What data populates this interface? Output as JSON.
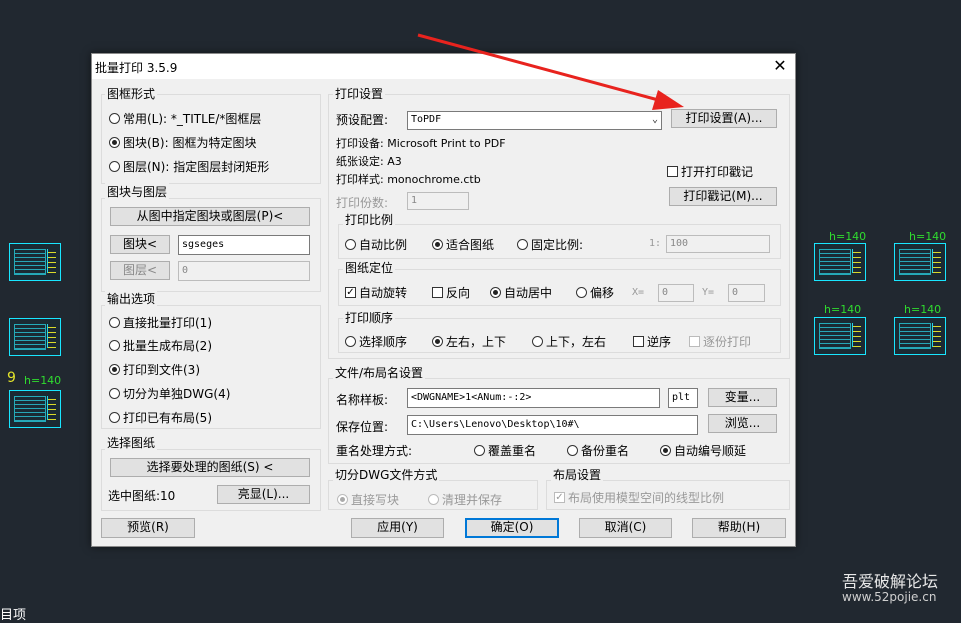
{
  "cad": {
    "labels": [
      "h=140",
      "h=140",
      "h=140",
      "h=140",
      "h=140"
    ],
    "number": "9",
    "bottom_text": "目项"
  },
  "dialog": {
    "title": "批量打印 3.5.9",
    "close": "✕",
    "frame_style": {
      "label": "图框形式",
      "options": [
        "常用(L): *_TITLE/*图框层",
        "图块(B): 图框为特定图块",
        "图层(N): 指定图层封闭矩形"
      ],
      "selected": 1
    },
    "block_layer": {
      "label": "图块与图层",
      "pick_button": "从图中指定图块或图层(P)<",
      "block_button": "图块<",
      "block_value": "sgseges",
      "layer_button": "图层<",
      "layer_value": "0"
    },
    "output": {
      "label": "输出选项",
      "options": [
        "直接批量打印(1)",
        "批量生成布局(2)",
        "打印到文件(3)",
        "切分为单独DWG(4)",
        "打印已有布局(5)"
      ],
      "selected": 2
    },
    "select_drawing": {
      "label": "选择图纸",
      "select_button": "选择要处理的图纸(S) <",
      "selected_count": "选中图纸:10",
      "highlight_button": "亮显(L)..."
    },
    "print_settings": {
      "label": "打印设置",
      "preset_label": "预设配置:",
      "preset_value": "ToPDF",
      "settings_button": "打印设置(A)...",
      "device": "打印设备: Microsoft Print to PDF",
      "paper": "纸张设定: A3",
      "style": "打印样式: monochrome.ctb",
      "copies_label": "打印份数:",
      "copies_value": "1",
      "open_stamp_label": "打开打印戳记",
      "stamp_button": "打印戳记(M)...",
      "scale": {
        "label": "打印比例",
        "options": [
          "自动比例",
          "适合图纸",
          "固定比例:"
        ],
        "selected": 1,
        "ratio_prefix": "1:",
        "ratio_value": "100"
      },
      "position": {
        "label": "图纸定位",
        "auto_rotate": "自动旋转",
        "reverse": "反向",
        "auto_center": "自动居中",
        "offset": "偏移",
        "x_label": "X=",
        "x_value": "0",
        "y_label": "Y=",
        "y_value": "0"
      },
      "order": {
        "label": "打印顺序",
        "options": [
          "选择顺序",
          "左右，上下",
          "上下，左右"
        ],
        "selected": 1,
        "reverse": "逆序",
        "one_by_one": "逐份打印"
      }
    },
    "file_naming": {
      "label": "文件/布局名设置",
      "template_label": "名称样板:",
      "template_value": "<DWGNAME>1<ANum:-:2>",
      "ext_value": "plt",
      "vars_button": "变量...",
      "save_label": "保存位置:",
      "save_value": "C:\\Users\\Lenovo\\Desktop\\10#\\",
      "browse_button": "浏览...",
      "rename_label": "重名处理方式:",
      "rename_options": [
        "覆盖重名",
        "备份重名",
        "自动编号顺延"
      ],
      "rename_selected": 2
    },
    "split_dwg": {
      "label": "切分DWG文件方式",
      "options": [
        "直接写块",
        "清理并保存"
      ],
      "selected": 0
    },
    "layout": {
      "label": "布局设置",
      "option": "布局使用模型空间的线型比例"
    },
    "buttons": {
      "preview": "预览(R)",
      "apply": "应用(Y)",
      "ok": "确定(O)",
      "cancel": "取消(C)",
      "help": "帮助(H)"
    }
  },
  "watermark": {
    "line1": "吾爱破解论坛",
    "line2": "www.52pojie.cn"
  }
}
